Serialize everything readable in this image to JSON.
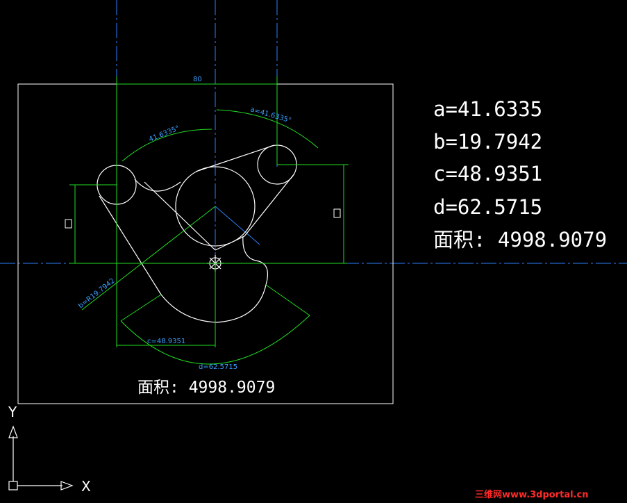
{
  "colors": {
    "background": "#000000",
    "geometry": "#ffffff",
    "dimension": "#22dd22",
    "centerline": "#2b7fff",
    "dim_text": "#3aa0ff",
    "watermark": "#ff2a2a"
  },
  "results": {
    "a": "a=41.6335",
    "b": "b=19.7942",
    "c": "c=48.9351",
    "d": "d=62.5715",
    "area": "面积: 4998.9079"
  },
  "dimensions": {
    "width": "80",
    "angle_left": "41.6335°",
    "angle_right": "a=41.6335°",
    "radius_b": "b=R19.7942",
    "length_c": "c=48.9351",
    "arc_d": "d=62.5715"
  },
  "drawing_area_label": "面积: 4998.9079",
  "ucs": {
    "x_label": "X",
    "y_label": "Y"
  },
  "watermark": "三维网www.3dportal.cn"
}
